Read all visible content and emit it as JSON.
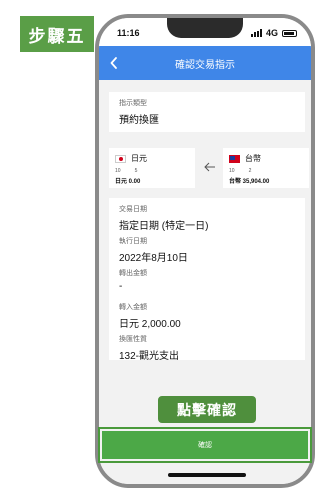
{
  "step_badge": "步驟五",
  "status_bar": {
    "time": "11:16",
    "network": "4G"
  },
  "nav": {
    "title": "確認交易指示"
  },
  "instruction_type": {
    "label": "指示類型",
    "value": "預約換匯"
  },
  "from_currency": {
    "name": "日元",
    "tier_left": "10",
    "tier_right": "5",
    "amount": "日元 0.00"
  },
  "to_currency": {
    "name": "台幣",
    "tier_left": "10",
    "tier_right": "2",
    "amount": "台幣 35,904.00"
  },
  "details": [
    {
      "label": "交易日期",
      "value": "指定日期 (特定一日)"
    },
    {
      "label": "執行日期",
      "value": "2022年8月10日"
    },
    {
      "label": "轉出金額",
      "value": "-"
    },
    {
      "label": "轉入金額",
      "value": "日元 2,000.00"
    },
    {
      "label": "換匯性質",
      "value": "132-觀光支出"
    }
  ],
  "callout": "點擊確認",
  "confirm_button": "確認",
  "colors": {
    "nav_blue": "#3f86e8",
    "confirm_green": "#4ca847",
    "badge_green": "#5a9e47"
  }
}
